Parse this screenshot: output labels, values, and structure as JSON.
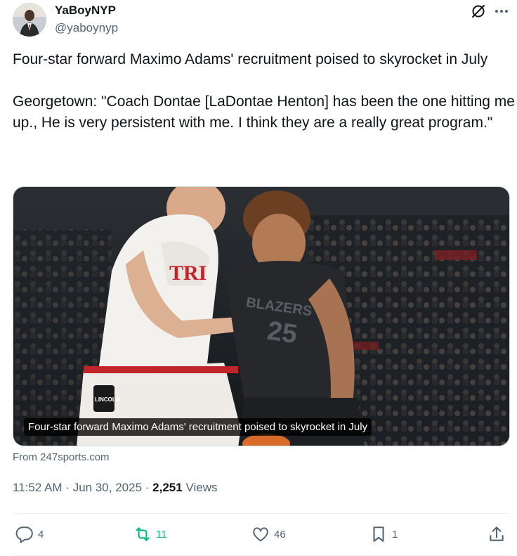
{
  "author": {
    "display_name": "YaBoyNYP",
    "handle": "@yaboynyp",
    "avatar_icon": "user-avatar"
  },
  "header_actions": {
    "grok_icon": "grok-icon",
    "more_icon": "more-icon"
  },
  "tweet": {
    "text": "Four-star forward Maximo Adams' recruitment poised to skyrocket in July\n\nGeorgetown: \"Coach Dontae [LaDontae Henton] has been the one hitting me up., He is very persistent with me. I think they are a really great program.\""
  },
  "media": {
    "caption": "Four-star forward Maximo Adams' recruitment poised to skyrocket in July",
    "jersey_left_text": "TRI",
    "jersey_right_text": "BLAZERS",
    "jersey_right_number": "25",
    "shorts_logo_text": "LINCOLN",
    "source": "From 247sports.com"
  },
  "meta": {
    "time": "11:52 AM",
    "separator": "·",
    "date": "Jun 30, 2025",
    "views_count": "2,251",
    "views_label": "Views"
  },
  "actions": {
    "reply_count": "4",
    "retweet_count": "11",
    "like_count": "46",
    "bookmark_count": "1"
  },
  "colors": {
    "text_primary": "#0f1419",
    "text_secondary": "#536471",
    "retweet_green": "#00ba7c",
    "divider": "#eff3f4"
  }
}
